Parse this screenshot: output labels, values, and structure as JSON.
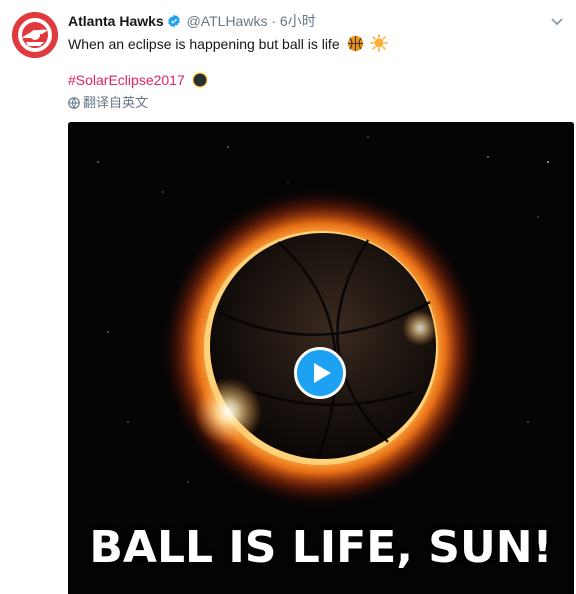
{
  "tweet": {
    "author_name": "Atlanta Hawks",
    "handle": "@ATLHawks",
    "separator": "·",
    "time": "6小时",
    "text": "When an eclipse is happening but ball is life",
    "hashtag": "#SolarEclipse2017",
    "translate_label": "翻译自英文"
  },
  "icons": [
    "hawks-logo",
    "verified-icon",
    "chevron-down-icon",
    "basketball-emoji",
    "sun-emoji",
    "solar-eclipse-emoji",
    "globe-icon",
    "play-icon"
  ],
  "media": {
    "caption": "BALL IS LIFE, SUN!"
  },
  "colors": {
    "hashtag": "#e0245e",
    "secondary_text": "#657786",
    "play_button": "#1da1f2",
    "brand_red": "#e03a3e"
  }
}
